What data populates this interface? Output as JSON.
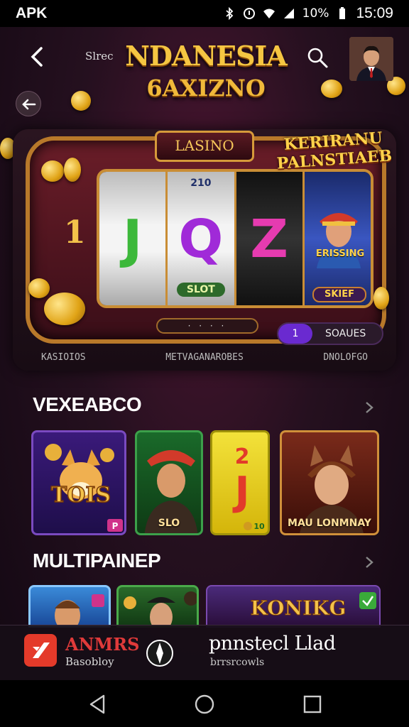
{
  "status_bar": {
    "carrier": "APK",
    "battery": "10%",
    "time": "15:09",
    "icons": [
      "bluetooth-icon",
      "alarm-icon",
      "wifi-icon",
      "signal-icon",
      "battery-icon"
    ]
  },
  "header": {
    "small_label": "Slrec",
    "logo_line1": "NDANESIA",
    "logo_line2": "6AXIZNO",
    "icons": [
      "back-arrow-icon",
      "search-icon",
      "avatar"
    ]
  },
  "hero": {
    "badge": "LASINO",
    "promo": "KERIRANU PALNSTIAEB",
    "reel_top": "210",
    "symbols": [
      "J",
      "Q",
      "Z"
    ],
    "reel_bottom": "SLOT",
    "side_number": "1",
    "portrait_label": "ERISSING",
    "portrait_button": "SKIEF",
    "coin_count": "1",
    "coin_label": "SOAUES",
    "labels": [
      "KASIOIOS",
      "METVAGANAROBES",
      "DNOLOFGO"
    ]
  },
  "section1": {
    "title": "VEXEABCO",
    "tiles": [
      {
        "label": "",
        "name": "TOIS",
        "badge": "P"
      },
      {
        "label": "SLO"
      },
      {
        "label": "",
        "badge": "10"
      },
      {
        "label": "MAU LONMNAY"
      }
    ]
  },
  "section2": {
    "title": "MULTIPAINEP",
    "tile_texts": [
      "KONIKG"
    ]
  },
  "bottom_bar": {
    "app_name": "ANMRS",
    "app_sub": "Basobloy",
    "promo_text": "pnnstecl Llad",
    "promo_sub": "brrsrcowls"
  },
  "colors": {
    "gold": "#f5c642",
    "background": "#140a18",
    "accent_red": "#e43a2a",
    "accent_purple": "#6a2ad0"
  }
}
